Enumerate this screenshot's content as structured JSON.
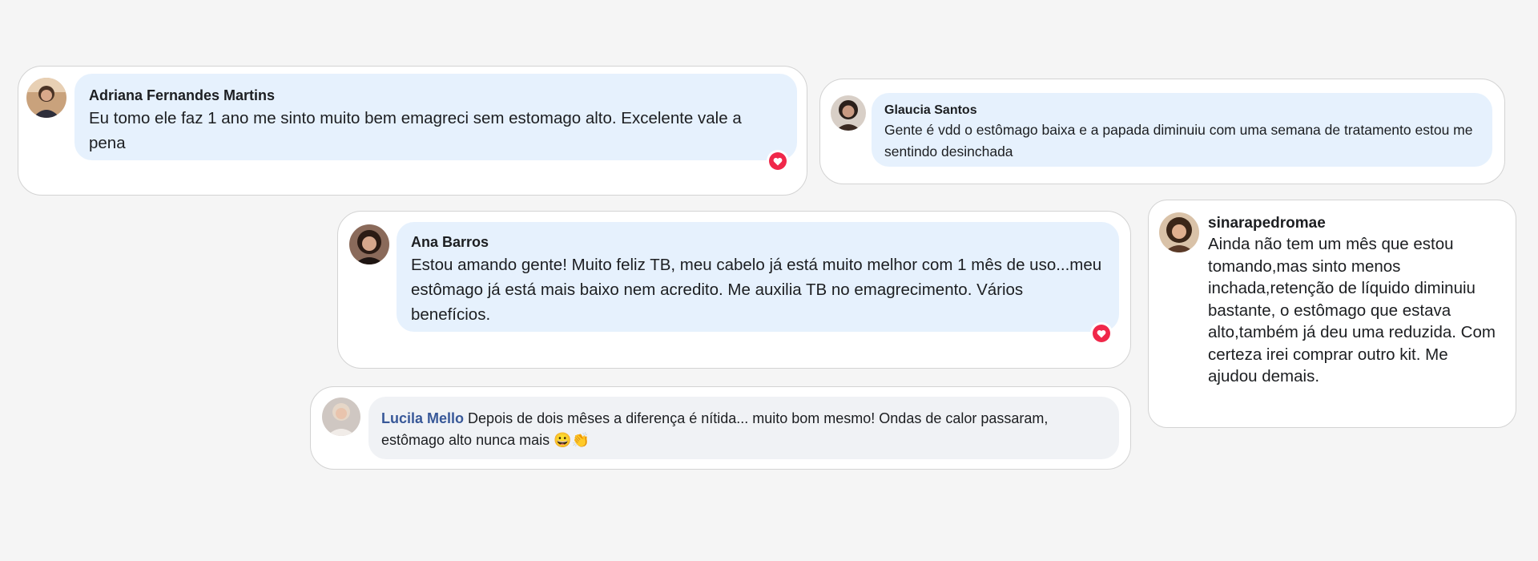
{
  "comments": [
    {
      "name": "Adriana Fernandes Martins",
      "text": "Eu tomo ele faz 1 ano me sinto muito bem emagreci sem estomago alto. Excelente vale a pena",
      "avatar": "woman-avatar",
      "liked": true
    },
    {
      "name": "Glaucia Santos",
      "text": "Gente é vdd o estômago baixa e a papada diminuiu com uma semana de tratamento estou me sentindo desinchada",
      "avatar": "woman-avatar",
      "liked": false
    },
    {
      "name": "Ana Barros",
      "text": "Estou amando gente! Muito feliz TB, meu cabelo já está muito melhor com 1 mês de uso...meu estômago já está mais baixo nem acredito. Me auxilia TB no emagrecimento. Vários benefícios.",
      "avatar": "woman-avatar",
      "liked": true
    },
    {
      "name": "sinarapedromae",
      "text": "Ainda não tem um mês que estou tomando,mas sinto menos inchada,retenção de líquido diminuiu bastante, o estômago que estava alto,também já deu uma reduzida. Com certeza irei comprar outro kit. Me ajudou demais.",
      "avatar": "woman-avatar",
      "liked": false
    },
    {
      "name": "Lucila Mello",
      "text": "Depois de dois mêses a diferença é nítida... muito bom mesmo! Ondas de calor passaram, estômago alto nunca mais",
      "emojis": "😀👏",
      "avatar": "woman-avatar",
      "liked": false
    }
  ],
  "colors": {
    "page_background": "#f5f5f5",
    "bubble_blue": "#e6f1fd",
    "bubble_gray": "#f0f2f5",
    "link_name": "#385898",
    "heart_red": "#f0284a"
  }
}
